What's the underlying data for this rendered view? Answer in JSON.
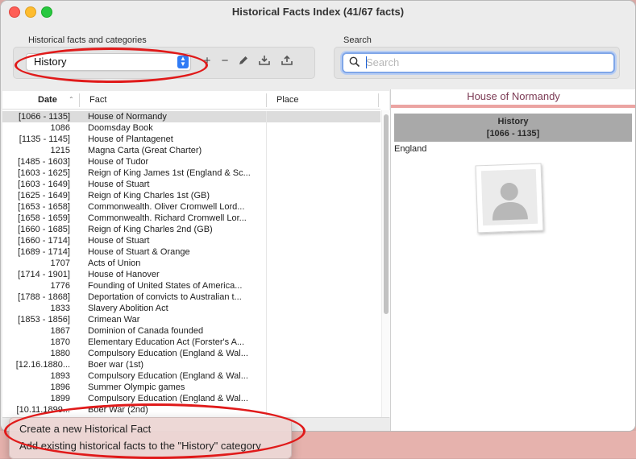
{
  "window": {
    "title": "Historical Facts Index (41/67 facts)",
    "controls": [
      "close-icon",
      "minimize-icon",
      "zoom-icon"
    ]
  },
  "toolbar": {
    "category_group_label": "Historical facts and categories",
    "category_selected": "History",
    "buttons": [
      "plus-icon",
      "minus-icon",
      "pencil-icon",
      "import-icon",
      "export-icon"
    ],
    "search_label": "Search",
    "search_placeholder": "Search",
    "search_value": ""
  },
  "table": {
    "columns": {
      "date": "Date",
      "fact": "Fact",
      "place": "Place"
    },
    "rows": [
      {
        "date": "[1066 - 1135]",
        "fact": "House of Normandy",
        "place": "",
        "selected": true
      },
      {
        "date": "1086",
        "fact": "Doomsday Book",
        "place": ""
      },
      {
        "date": "[1135 - 1145]",
        "fact": "House of Plantagenet",
        "place": ""
      },
      {
        "date": "1215",
        "fact": "Magna Carta (Great Charter)",
        "place": ""
      },
      {
        "date": "[1485 - 1603]",
        "fact": "House of Tudor",
        "place": ""
      },
      {
        "date": "[1603 - 1625]",
        "fact": "Reign of King James 1st (England & Sc...",
        "place": ""
      },
      {
        "date": "[1603 - 1649]",
        "fact": "House of Stuart",
        "place": ""
      },
      {
        "date": "[1625 - 1649]",
        "fact": "Reign of King Charles 1st (GB)",
        "place": ""
      },
      {
        "date": "[1653 - 1658]",
        "fact": "Commonwealth. Oliver Cromwell Lord...",
        "place": ""
      },
      {
        "date": "[1658 - 1659]",
        "fact": "Commonwealth. Richard Cromwell Lor...",
        "place": ""
      },
      {
        "date": "[1660 - 1685]",
        "fact": "Reign of King Charles 2nd (GB)",
        "place": ""
      },
      {
        "date": "[1660 - 1714]",
        "fact": "House of Stuart",
        "place": ""
      },
      {
        "date": "[1689 - 1714]",
        "fact": "House of Stuart & Orange",
        "place": ""
      },
      {
        "date": "1707",
        "fact": "Acts of Union",
        "place": ""
      },
      {
        "date": "[1714 - 1901]",
        "fact": "House of Hanover",
        "place": ""
      },
      {
        "date": "1776",
        "fact": "Founding of United States of America...",
        "place": ""
      },
      {
        "date": "[1788 - 1868]",
        "fact": "Deportation of convicts to Australian t...",
        "place": ""
      },
      {
        "date": "1833",
        "fact": "Slavery Abolition Act",
        "place": ""
      },
      {
        "date": "[1853 - 1856]",
        "fact": "Crimean War",
        "place": ""
      },
      {
        "date": "1867",
        "fact": "Dominion of Canada founded",
        "place": ""
      },
      {
        "date": "1870",
        "fact": "Elementary Education Act (Forster's A...",
        "place": ""
      },
      {
        "date": "1880",
        "fact": "Compulsory Education (England & Wal...",
        "place": ""
      },
      {
        "date": "[12.16.1880...",
        "fact": "Boer war (1st)",
        "place": ""
      },
      {
        "date": "1893",
        "fact": "Compulsory Education (England & Wal...",
        "place": ""
      },
      {
        "date": "1896",
        "fact": "Summer Olympic games",
        "place": ""
      },
      {
        "date": "1899",
        "fact": "Compulsory Education (England & Wal...",
        "place": ""
      },
      {
        "date": "[10.11.1899...",
        "fact": "Boer War (2nd)",
        "place": ""
      }
    ]
  },
  "detail": {
    "title": "House of Normandy",
    "category": "History",
    "dates": "[1066 - 1135]",
    "place": "England",
    "photo_icon": "person-silhouette-icon"
  },
  "context_menu": {
    "items": [
      "Create a new Historical Fact",
      "Add existing historical facts to the \"History\" category"
    ]
  }
}
